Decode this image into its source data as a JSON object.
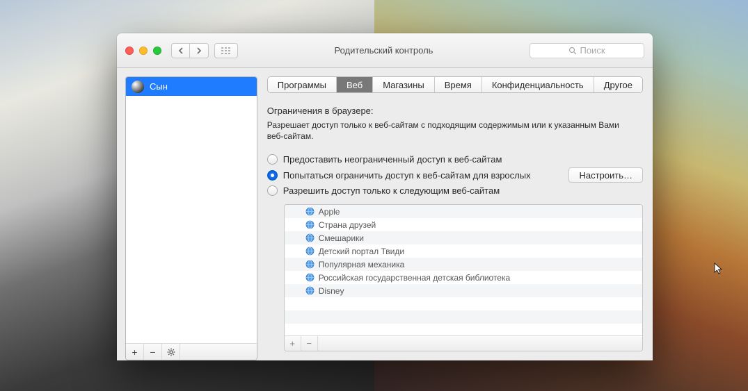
{
  "window": {
    "title": "Родительский контроль"
  },
  "search": {
    "placeholder": "Поиск"
  },
  "sidebar": {
    "users": [
      {
        "name": "Сын"
      }
    ]
  },
  "tabs": [
    {
      "label": "Программы"
    },
    {
      "label": "Веб",
      "active": true
    },
    {
      "label": "Магазины"
    },
    {
      "label": "Время"
    },
    {
      "label": "Конфиденциальность"
    },
    {
      "label": "Другое"
    }
  ],
  "section": {
    "title": "Ограничения в браузере:",
    "desc": "Разрешает доступ только к веб-сайтам с подходящим содержимым или к указанным Вами веб-сайтам."
  },
  "radios": [
    {
      "label": "Предоставить неограниченный доступ к веб-сайтам",
      "selected": false
    },
    {
      "label": "Попытаться ограничить доступ к веб-сайтам для взрослых",
      "selected": true
    },
    {
      "label": "Разрешить доступ только к следующим веб-сайтам",
      "selected": false
    }
  ],
  "configure_btn": "Настроить…",
  "sites": [
    "Apple",
    "Страна друзей",
    "Смешарики",
    "Детский портал Твиди",
    "Популярная механика",
    "Российская государственная детская библиотека",
    "Disney"
  ]
}
